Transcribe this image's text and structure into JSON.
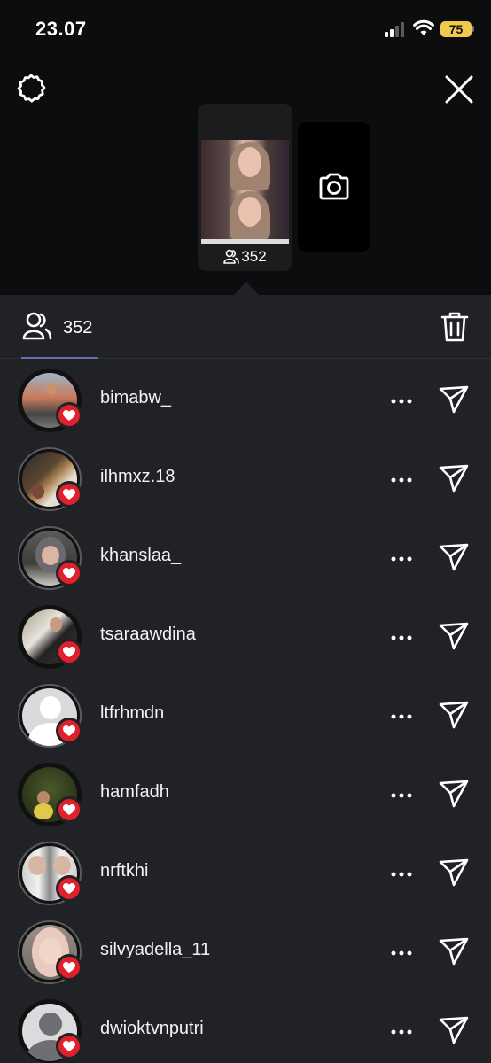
{
  "status_bar": {
    "time": "23.07",
    "battery": "75"
  },
  "story": {
    "viewer_count": "352"
  },
  "viewers": {
    "count": "352",
    "list": [
      {
        "username": "bimabw_"
      },
      {
        "username": "ilhmxz.18"
      },
      {
        "username": "khanslaa_"
      },
      {
        "username": "tsaraawdina"
      },
      {
        "username": "ltfrhmdn"
      },
      {
        "username": "hamfadh"
      },
      {
        "username": "nrftkhi"
      },
      {
        "username": "silvyadella_11"
      },
      {
        "username": "dwioktvnputri"
      }
    ]
  },
  "icons": {
    "settings": "gear-icon",
    "close": "close-icon",
    "camera": "camera-icon",
    "viewers": "people-icon",
    "delete": "trash-icon",
    "more": "more-icon",
    "send": "send-icon",
    "like": "heart-icon"
  },
  "colors": {
    "background": "#0c0d0f",
    "sheet": "#212226",
    "heart": "#e0202c",
    "battery": "#f2c94c"
  }
}
